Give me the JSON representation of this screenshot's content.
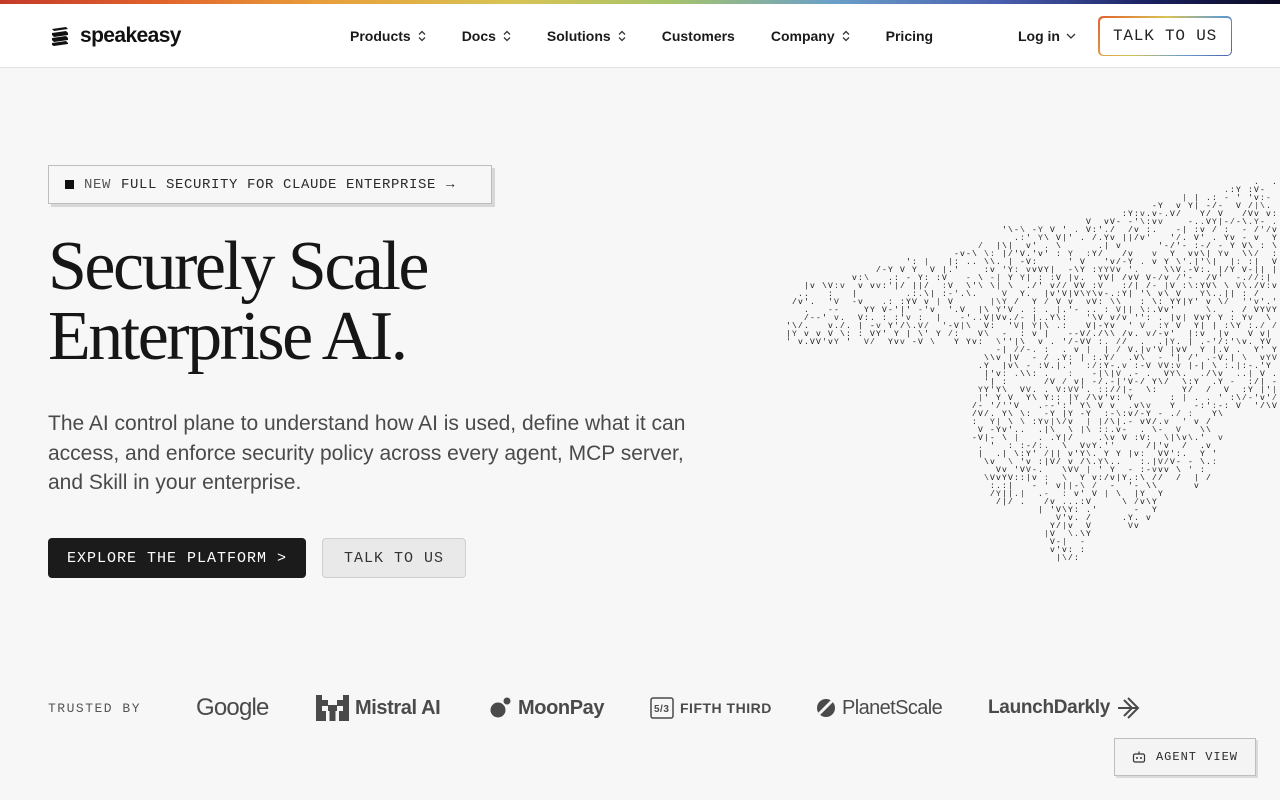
{
  "brand": {
    "name": "speakeasy"
  },
  "nav": {
    "items": [
      {
        "label": "Products",
        "has_menu": true
      },
      {
        "label": "Docs",
        "has_menu": true
      },
      {
        "label": "Solutions",
        "has_menu": true
      },
      {
        "label": "Customers",
        "has_menu": false
      },
      {
        "label": "Company",
        "has_menu": true
      },
      {
        "label": "Pricing",
        "has_menu": false
      }
    ],
    "login_label": "Log in",
    "cta_label": "TALK TO US"
  },
  "announcement": {
    "tag": "NEW",
    "text": "FULL SECURITY FOR CLAUDE ENTERPRISE",
    "arrow": "→"
  },
  "hero": {
    "title_line1": "Securely Scale",
    "title_line2": "Enterprise AI.",
    "subtitle": "The AI control plane to understand how AI is used, define what it can access, and enforce security policy across every agent, MCP server, and Skill in your enterprise.",
    "primary_cta": "EXPLORE THE PLATFORM >",
    "secondary_cta": "TALK TO US"
  },
  "trusted": {
    "label": "TRUSTED BY",
    "logos": [
      "Google",
      "Mistral AI",
      "MoonPay",
      "FIFTH THIRD",
      "PlanetScale",
      "LaunchDarkly"
    ]
  },
  "agent_view": {
    "label": "AGENT VIEW"
  },
  "colors": {
    "accent_dark": "#1b1b1b",
    "background": "#f7f7f7",
    "header_bg": "#ffffff"
  }
}
